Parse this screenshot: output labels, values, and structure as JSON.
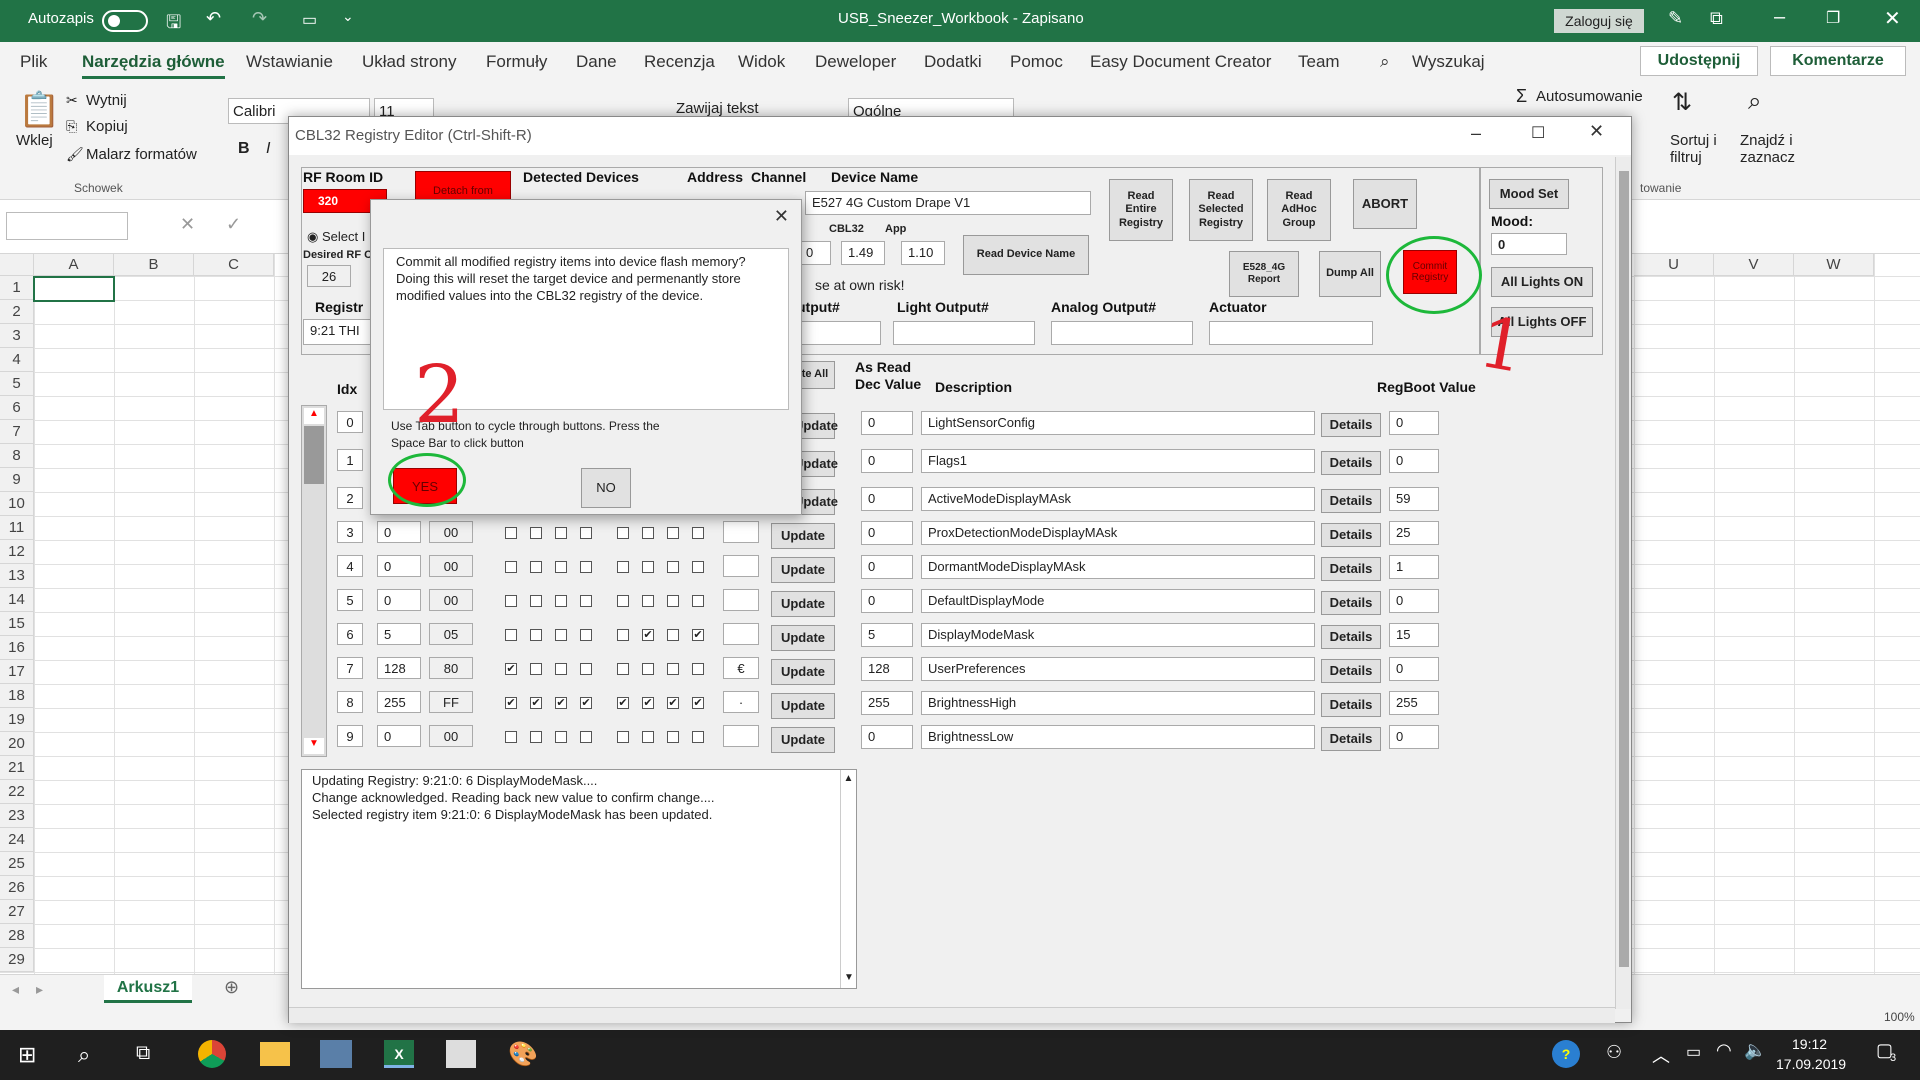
{
  "window": {
    "autosave_label": "Autozapis",
    "title": "USB_Sneezer_Workbook  -  Zapisano",
    "login_label": "Zaloguj się"
  },
  "menu": {
    "items": [
      "Plik",
      "Narzędzia główne",
      "Wstawianie",
      "Układ strony",
      "Formuły",
      "Dane",
      "Recenzja",
      "Widok",
      "Deweloper",
      "Dodatki",
      "Pomoc",
      "Easy Document Creator",
      "Team"
    ],
    "search": "Wyszukaj",
    "share": "Udostępnij",
    "comments": "Komentarze"
  },
  "ribbon": {
    "paste": "Wklej",
    "cut": "Wytnij",
    "copy": "Kopiuj",
    "format_painter": "Malarz formatów",
    "clipboard_group": "Schowek",
    "font_name": "Calibri",
    "font_size": "11",
    "wrap_text": "Zawijaj tekst",
    "number_format": "Ogólne",
    "autosum": "Autosumowanie",
    "sort": "Sortuj i\nfiltruj",
    "find": "Znajdź i\nzaznacz",
    "styles_group": "towanie"
  },
  "sheet": {
    "columns": [
      "A",
      "B",
      "C",
      "U",
      "V",
      "W"
    ],
    "rows": [
      "1",
      "2",
      "3",
      "4",
      "5",
      "6",
      "7",
      "8",
      "9",
      "10",
      "11",
      "12",
      "13",
      "14",
      "15",
      "16",
      "17",
      "18",
      "19",
      "20",
      "21",
      "22",
      "23",
      "24",
      "25",
      "26",
      "27",
      "28",
      "29"
    ],
    "tab": "Arkusz1",
    "zoom": "100%"
  },
  "editor": {
    "title": "CBL32 Registry Editor (Ctrl-Shift-R)",
    "rf_room_label": "RF Room ID",
    "rf_room_value": "320",
    "detach_label": "Detach from",
    "detected_devices_label": "Detected Devices",
    "address_label": "Address",
    "channel_label": "Channel",
    "device_name_label": "Device Name",
    "device_name_value": "E527 4G Custom Drape V1",
    "select_label": "Select I",
    "desired_rf_label": "Desired RF C",
    "desired_rf_value": "26",
    "cbl32_label": "CBL32",
    "cbl32_value": "1.49",
    "app_label": "App",
    "app_value": "1.10",
    "ver_value": "0",
    "read_device_name": "Read Device Name",
    "read_entire": "Read\nEntire\nRegistry",
    "read_selected": "Read\nSelected\nRegistry",
    "read_adhoc": "Read\nAdHoc\nGroup",
    "abort": "ABORT",
    "commit": "Commit\nRegistry",
    "e528_report": "E528_4G\nReport",
    "dump_all": "Dump All",
    "risk_text": "se at own risk!",
    "registry_label": "Registr",
    "registry_value": "9:21  THI",
    "output_label": "utput#",
    "light_output_label": "Light Output#",
    "analog_output_label": "Analog Output#",
    "actuator_label": "Actuator",
    "mood_set": "Mood Set",
    "mood_label": "Mood:",
    "mood_value": "0",
    "all_on": "All Lights ON",
    "all_off": "All Lights OFF",
    "idx_header": "Idx",
    "update_all": "te All",
    "as_read_header": "As Read\nDec Value",
    "description_header": "Description",
    "regboot_header": "RegBoot Value",
    "update_label": "Update",
    "details_label": "Details",
    "rows": [
      {
        "idx": "0",
        "dec": "",
        "hex": "",
        "checks": "",
        "chr": "",
        "read": "0",
        "desc": "LightSensorConfig",
        "boot": "0"
      },
      {
        "idx": "1",
        "dec": "",
        "hex": "",
        "checks": "",
        "chr": "",
        "read": "0",
        "desc": "Flags1",
        "boot": "0"
      },
      {
        "idx": "2",
        "dec": "",
        "hex": "",
        "checks": "",
        "chr": "",
        "read": "0",
        "desc": "ActiveModeDisplayMAsk",
        "boot": "59"
      },
      {
        "idx": "3",
        "dec": "0",
        "hex": "00",
        "checks": "00000000",
        "chr": "",
        "read": "0",
        "desc": "ProxDetectionModeDisplayMAsk",
        "boot": "25"
      },
      {
        "idx": "4",
        "dec": "0",
        "hex": "00",
        "checks": "00000000",
        "chr": "",
        "read": "0",
        "desc": "DormantModeDisplayMAsk",
        "boot": "1"
      },
      {
        "idx": "5",
        "dec": "0",
        "hex": "00",
        "checks": "00000000",
        "chr": "",
        "read": "0",
        "desc": "DefaultDisplayMode",
        "boot": "0"
      },
      {
        "idx": "6",
        "dec": "5",
        "hex": "05",
        "checks": "00000101",
        "chr": "",
        "read": "5",
        "desc": "DisplayModeMask",
        "boot": "15"
      },
      {
        "idx": "7",
        "dec": "128",
        "hex": "80",
        "checks": "10000000",
        "chr": "€",
        "read": "128",
        "desc": "UserPreferences",
        "boot": "0"
      },
      {
        "idx": "8",
        "dec": "255",
        "hex": "FF",
        "checks": "11111111",
        "chr": "·",
        "read": "255",
        "desc": "BrightnessHigh",
        "boot": "255"
      },
      {
        "idx": "9",
        "dec": "0",
        "hex": "00",
        "checks": "00000000",
        "chr": "",
        "read": "0",
        "desc": "BrightnessLow",
        "boot": "0"
      }
    ],
    "log": [
      "Updating Registry: 9:21:0: 6   DisplayModeMask....",
      "Change acknowledged.  Reading back new value to confirm change....",
      "Selected registry item 9:21:0: 6   DisplayModeMask has been updated."
    ]
  },
  "dialog": {
    "message": "Commit all modified registry items into device flash memory? Doing this will reset the target device and permenantly store modified values into the CBL32 registry of the device.",
    "hint": "Use Tab button to cycle through buttons. Press the Space Bar to click button",
    "yes": "YES",
    "no": "NO"
  },
  "annotations": {
    "step1": "1",
    "step2": "2",
    "circle_color": "#1db83a",
    "mark_color": "#e0202a"
  },
  "taskbar": {
    "time": "19:12",
    "date": "17.09.2019",
    "notifications": "3"
  },
  "colors": {
    "excel_green": "#217346",
    "red_button": "#ff0000"
  }
}
